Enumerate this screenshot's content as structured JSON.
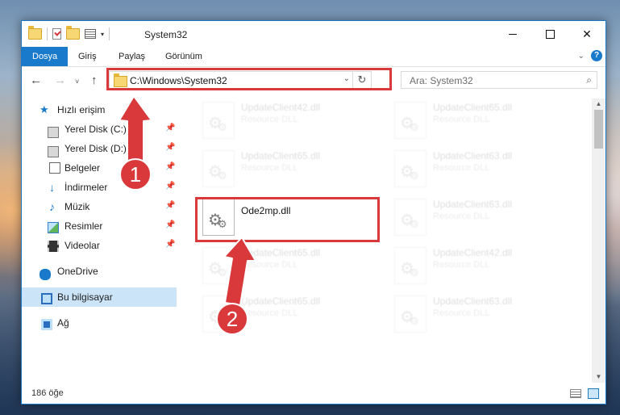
{
  "window": {
    "title": "System32",
    "min_icon": "minimize-icon",
    "max_icon": "maximize-icon",
    "close_glyph": "✕"
  },
  "ribbon": {
    "tabs": [
      "Dosya",
      "Giriş",
      "Paylaş",
      "Görünüm"
    ],
    "help": "?"
  },
  "nav": {
    "back": "←",
    "forward": "→",
    "recent": "˅",
    "up": "↑",
    "address": "C:\\Windows\\System32",
    "search_placeholder": "Ara: System32"
  },
  "sidebar": {
    "items": [
      {
        "label": "Hızlı erişim",
        "icon": "star-icon"
      },
      {
        "label": "Yerel Disk (C:)",
        "icon": "drive-icon",
        "pinned": true
      },
      {
        "label": "Yerel Disk (D:)",
        "icon": "drive-icon",
        "pinned": true
      },
      {
        "label": "Belgeler",
        "icon": "document-icon",
        "pinned": true
      },
      {
        "label": "İndirmeler",
        "icon": "download-icon",
        "pinned": true
      },
      {
        "label": "Müzik",
        "icon": "music-icon",
        "pinned": true
      },
      {
        "label": "Resimler",
        "icon": "pictures-icon",
        "pinned": true
      },
      {
        "label": "Videolar",
        "icon": "videos-icon",
        "pinned": true
      },
      {
        "label": "OneDrive",
        "icon": "cloud-icon"
      },
      {
        "label": "Bu bilgisayar",
        "icon": "computer-icon",
        "selected": true
      },
      {
        "label": "Ağ",
        "icon": "network-icon"
      }
    ]
  },
  "files": [
    {
      "name": "UpdateClient42.dll",
      "desc": "Resource DLL",
      "faded": true
    },
    {
      "name": "UpdateClient65.dll",
      "desc": "Resource DLL",
      "faded": true
    },
    {
      "name": "UpdateClient65.dll",
      "desc": "Resource DLL",
      "faded": true
    },
    {
      "name": "UpdateClient63.dll",
      "desc": "Resource DLL",
      "faded": true
    },
    {
      "name": "Ode2mp.dll",
      "desc": "",
      "faded": false
    },
    {
      "name": "UpdateClient63.dll",
      "desc": "Resource DLL",
      "faded": true
    },
    {
      "name": "UpdateClient65.dll",
      "desc": "Resource DLL",
      "faded": true
    },
    {
      "name": "UpdateClient42.dll",
      "desc": "Resource DLL",
      "faded": true
    },
    {
      "name": "UpdateClient65.dll",
      "desc": "Resource DLL",
      "faded": true
    },
    {
      "name": "UpdateClient63.dll",
      "desc": "Resource DLL",
      "faded": true
    }
  ],
  "status": {
    "count": "186 öğe"
  },
  "annotations": {
    "step1": "1",
    "step2": "2",
    "color": "#d9393b"
  },
  "colors": {
    "accent": "#1979ca",
    "highlight": "#d9393b",
    "selected_bg": "#cce4f7"
  }
}
